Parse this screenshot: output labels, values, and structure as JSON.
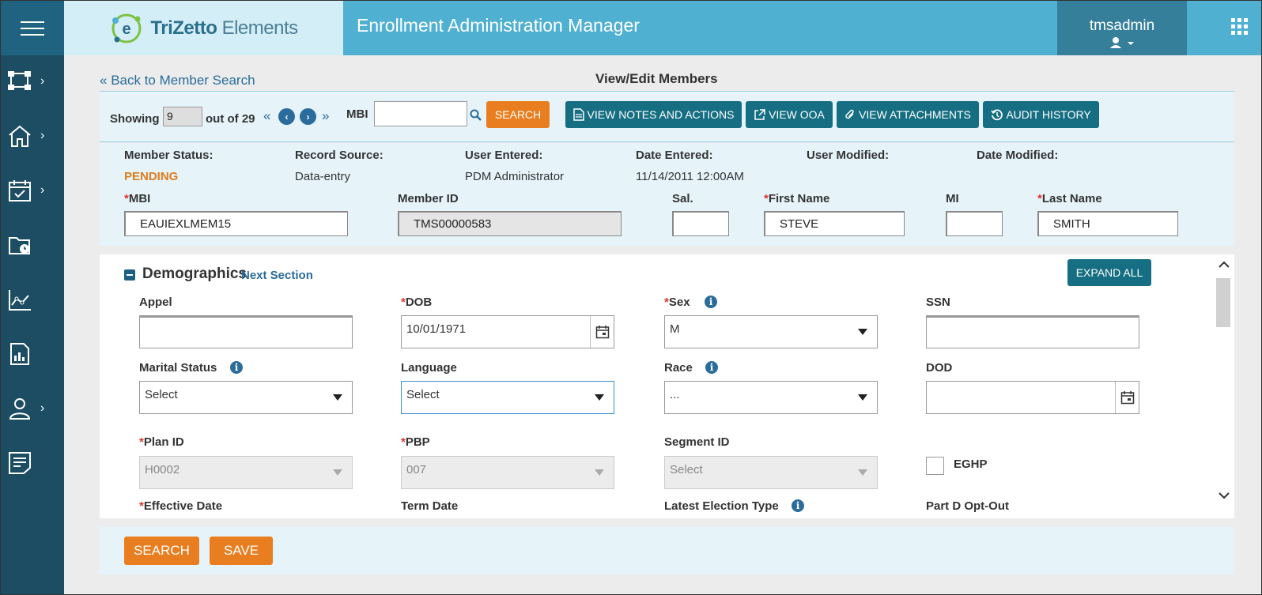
{
  "header": {
    "brand_name": "TriZetto",
    "brand_suffix": "Elements",
    "app_title": "Enrollment Administration Manager",
    "username": "tmsadmin"
  },
  "sidebar": {
    "items": [
      {
        "icon": "hierarchy-icon",
        "has_chevron": true
      },
      {
        "icon": "home-icon",
        "has_chevron": true
      },
      {
        "icon": "calendar-check-icon",
        "has_chevron": true
      },
      {
        "icon": "folder-clock-icon",
        "has_chevron": false
      },
      {
        "icon": "line-chart-icon",
        "has_chevron": false
      },
      {
        "icon": "report-icon",
        "has_chevron": false
      },
      {
        "icon": "user-icon",
        "has_chevron": true
      },
      {
        "icon": "notes-icon",
        "has_chevron": false
      }
    ]
  },
  "page": {
    "back_link": "Back to Member Search",
    "title": "View/Edit Members"
  },
  "toolbar": {
    "showing_label": "Showing",
    "current_index": "9",
    "out_of_label": "out of 29",
    "mbi_label": "MBI",
    "mbi_value": "",
    "search_label": "SEARCH",
    "view_notes_label": "VIEW NOTES AND ACTIONS",
    "view_ooa_label": "VIEW OOA",
    "view_attachments_label": "VIEW ATTACHMENTS",
    "audit_history_label": "AUDIT HISTORY"
  },
  "member": {
    "status_label": "Member Status:",
    "status_value": "PENDING",
    "status_color": "#e07b1c",
    "record_source_label": "Record Source:",
    "record_source_value": "Data-entry",
    "user_entered_label": "User Entered:",
    "user_entered_value": "PDM Administrator",
    "date_entered_label": "Date Entered:",
    "date_entered_value": "11/14/2011 12:00AM",
    "user_modified_label": "User Modified:",
    "date_modified_label": "Date Modified:",
    "mbi_label": "MBI",
    "mbi_value": "EAUIEXLMEM15",
    "member_id_label": "Member ID",
    "member_id_value": "TMS00000583",
    "sal_label": "Sal.",
    "sal_value": "",
    "first_name_label": "First Name",
    "first_name_value": "STEVE",
    "mi_label": "MI",
    "mi_value": "",
    "last_name_label": "Last Name",
    "last_name_value": "SMITH"
  },
  "demographics": {
    "section_title": "Demographics",
    "next_section_label": "Next Section",
    "expand_all_label": "EXPAND ALL",
    "appel_label": "Appel",
    "appel_value": "",
    "dob_label": "DOB",
    "dob_value": "10/01/1971",
    "sex_label": "Sex",
    "sex_value": "M",
    "ssn_label": "SSN",
    "ssn_value": "",
    "marital_label": "Marital Status",
    "marital_value": "Select",
    "language_label": "Language",
    "language_value": "Select",
    "race_label": "Race",
    "race_value": "...",
    "dod_label": "DOD",
    "dod_value": "",
    "plan_id_label": "Plan ID",
    "plan_id_value": "H0002",
    "pbp_label": "PBP",
    "pbp_value": "007",
    "segment_label": "Segment ID",
    "segment_value": "Select",
    "eghp_label": "EGHP",
    "effective_date_label": "Effective Date",
    "term_date_label": "Term Date",
    "latest_election_label": "Latest Election Type",
    "part_d_label": "Part D Opt-Out"
  },
  "footer": {
    "search_label": "SEARCH",
    "save_label": "SAVE"
  },
  "colors": {
    "header_blue": "#4fb0d2",
    "sidebar_dark": "#1d4d63",
    "accent_orange": "#e87e1f",
    "button_teal": "#166e82",
    "link_blue": "#2a6c9b"
  }
}
